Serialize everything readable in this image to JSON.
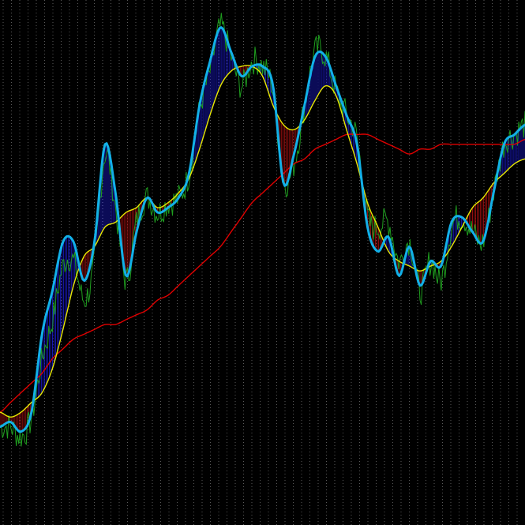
{
  "chart_data": {
    "type": "line",
    "title": "",
    "xlabel": "",
    "ylabel": "",
    "grid": true,
    "xlim": [
      0,
      100
    ],
    "ylim": [
      0,
      100
    ],
    "colors": {
      "background": "#000000",
      "grid": "#5a5a5a",
      "price": "#1f9e1f",
      "fast_line": "#12b0e8",
      "medium_line": "#e8e800",
      "slow_line": "#e00000",
      "band_bull": "#1a1acc",
      "band_bear": "#aa1010"
    },
    "x": [
      0,
      2,
      4,
      6,
      8,
      10,
      12,
      14,
      16,
      18,
      20,
      22,
      24,
      26,
      28,
      30,
      32,
      34,
      36,
      38,
      40,
      42,
      44,
      46,
      48,
      50,
      52,
      54,
      56,
      58,
      60,
      62,
      64,
      66,
      68,
      70,
      72,
      74,
      76,
      78,
      80,
      82,
      84,
      86,
      88,
      90,
      92,
      94,
      96,
      98,
      100
    ],
    "series": [
      {
        "key": "price",
        "values": [
          14,
          14,
          12,
          16,
          28,
          36,
          47,
          48,
          40,
          48,
          70,
          59,
          44,
          56,
          61,
          58,
          60,
          61,
          66,
          79,
          87,
          96,
          90,
          84,
          89,
          88,
          83,
          65,
          68,
          80,
          91,
          90,
          83,
          78,
          73,
          57,
          55,
          56,
          48,
          52,
          42,
          48,
          44,
          55,
          57,
          54,
          52,
          62,
          72,
          74,
          76
        ]
      },
      {
        "key": "fast",
        "values": [
          14,
          15,
          13,
          17,
          33,
          42,
          52,
          52,
          44,
          52,
          72,
          62,
          45,
          54,
          61,
          58,
          59,
          61,
          66,
          80,
          89,
          96,
          91,
          86,
          88,
          88,
          84,
          64,
          70,
          80,
          90,
          90,
          84,
          78,
          72,
          55,
          50,
          53,
          45,
          51,
          43,
          48,
          47,
          56,
          57,
          54,
          52,
          62,
          72,
          74,
          76
        ]
      },
      {
        "key": "medium",
        "values": [
          17,
          16,
          17,
          19,
          21,
          26,
          34,
          43,
          49,
          51,
          55,
          56,
          58,
          59,
          61,
          59,
          60,
          62,
          65,
          71,
          78,
          84,
          87,
          88,
          88,
          86,
          80,
          76,
          75,
          77,
          81,
          84,
          82,
          75,
          68,
          60,
          55,
          50,
          48,
          47,
          46,
          47,
          48,
          51,
          55,
          59,
          61,
          64,
          66,
          68,
          69
        ]
      },
      {
        "key": "slow",
        "values": [
          17,
          19,
          21,
          23,
          25,
          28,
          30,
          32,
          33,
          34,
          35,
          35,
          36,
          37,
          38,
          40,
          41,
          43,
          45,
          47,
          49,
          51,
          54,
          57,
          60,
          62,
          64,
          66,
          68,
          69,
          71,
          72,
          73,
          74,
          74,
          74,
          73,
          72,
          71,
          70,
          71,
          71,
          72,
          72,
          72,
          72,
          72,
          72,
          72,
          72,
          73
        ]
      }
    ]
  }
}
